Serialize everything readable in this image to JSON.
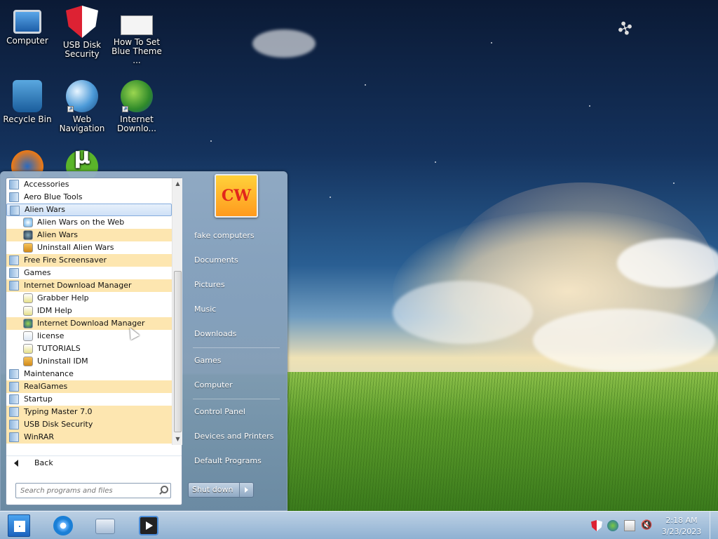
{
  "desktop": {
    "icons": [
      {
        "label": "Computer",
        "icon": "computer-icon"
      },
      {
        "label": "USB Disk Security",
        "icon": "usb-disk-security-icon"
      },
      {
        "label": "How To Set Blue Theme ...",
        "icon": "document-icon"
      },
      {
        "label": "Recycle Bin",
        "icon": "recycle-bin-icon"
      },
      {
        "label": "Web Navigation",
        "icon": "globe-icon"
      },
      {
        "label": "Internet Downlo...",
        "icon": "idm-icon"
      }
    ]
  },
  "start_menu": {
    "programs": [
      {
        "label": "Accessories",
        "type": "folder"
      },
      {
        "label": "Aero Blue Tools",
        "type": "folder"
      },
      {
        "label": "Alien Wars",
        "type": "folder",
        "selected": true
      },
      {
        "label": "Alien Wars on the Web",
        "type": "app",
        "icon": "web-link-icon"
      },
      {
        "label": "Alien Wars",
        "type": "app",
        "icon": "alien-wars-icon",
        "highlight": true
      },
      {
        "label": "Uninstall Alien Wars",
        "type": "app",
        "icon": "uninstall-icon"
      },
      {
        "label": "Free Fire Screensaver",
        "type": "folder",
        "highlight": true
      },
      {
        "label": "Games",
        "type": "folder"
      },
      {
        "label": "Internet Download Manager",
        "type": "folder",
        "highlight": true
      },
      {
        "label": "Grabber Help",
        "type": "app",
        "icon": "help-file-icon"
      },
      {
        "label": "IDM Help",
        "type": "app",
        "icon": "help-file-icon"
      },
      {
        "label": "Internet Download Manager",
        "type": "app",
        "icon": "idm-icon",
        "highlight": true
      },
      {
        "label": "license",
        "type": "app",
        "icon": "text-file-icon"
      },
      {
        "label": "TUTORIALS",
        "type": "app",
        "icon": "help-file-icon"
      },
      {
        "label": "Uninstall IDM",
        "type": "app",
        "icon": "uninstall-icon"
      },
      {
        "label": "Maintenance",
        "type": "folder"
      },
      {
        "label": "RealGames",
        "type": "folder",
        "highlight": true
      },
      {
        "label": "Startup",
        "type": "folder"
      },
      {
        "label": "Typing Master 7.0",
        "type": "folder",
        "highlight": true
      },
      {
        "label": "USB Disk Security",
        "type": "folder",
        "highlight": true
      },
      {
        "label": "WinRAR",
        "type": "folder",
        "highlight": true
      }
    ],
    "back_label": "Back",
    "search_placeholder": "Search programs and files",
    "user_picture_text": "CW",
    "right_items": [
      "fake computers",
      "Documents",
      "Pictures",
      "Music",
      "Downloads",
      "Games",
      "Computer",
      "Control Panel",
      "Devices and Printers",
      "Default Programs"
    ],
    "shutdown_label": "Shut down"
  },
  "taskbar": {
    "pinned": [
      {
        "name": "internet-explorer-icon"
      },
      {
        "name": "windows-explorer-icon"
      },
      {
        "name": "media-player-icon"
      }
    ],
    "tray": [
      "usb-disk-security-tray-icon",
      "network-tray-icon",
      "action-center-icon",
      "volume-muted-icon"
    ],
    "time": "2:18 AM",
    "date": "3/23/2023"
  }
}
